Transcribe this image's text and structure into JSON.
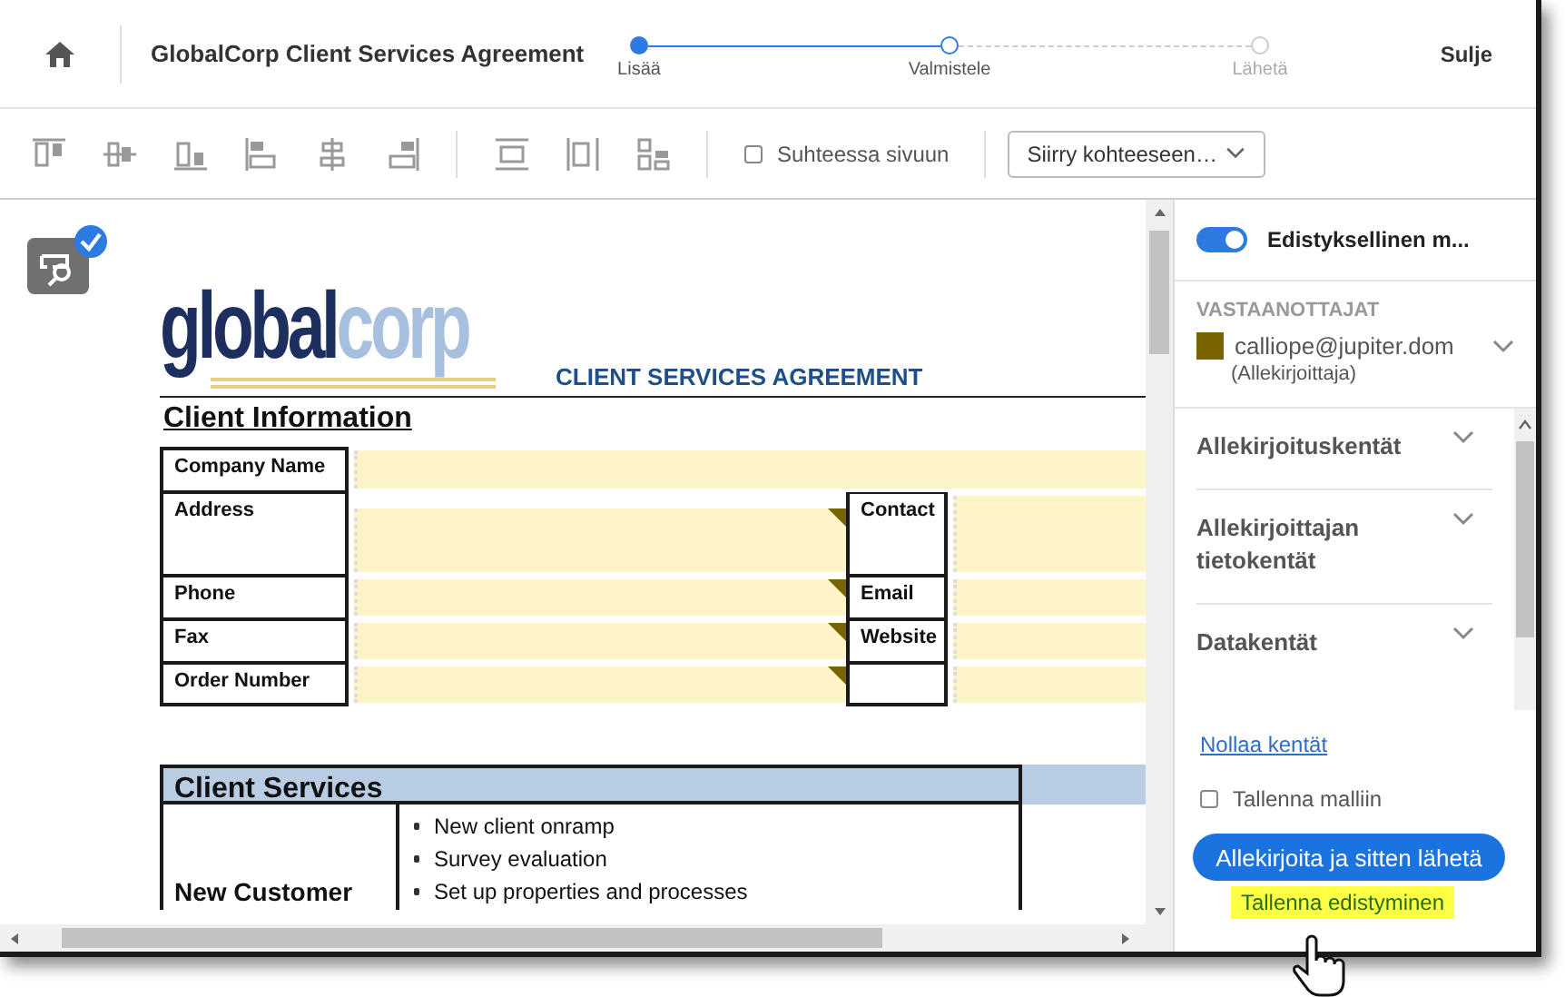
{
  "header": {
    "title": "GlobalCorp Client Services Agreement",
    "close": "Sulje"
  },
  "steps": [
    {
      "label": "Lisää",
      "kind": "done"
    },
    {
      "label": "Valmistele",
      "kind": "current"
    },
    {
      "label": "Lähetä",
      "kind": "pending"
    }
  ],
  "toolbar": {
    "fit_to_page": {
      "label": "Suhteessa sivuun",
      "checked": false
    },
    "goto": {
      "value": "Siirry kohteeseen…"
    }
  },
  "document": {
    "logo": [
      "global",
      "corp"
    ],
    "heading": "CLIENT SERVICES AGREEMENT",
    "section_title": "Client Information",
    "client_info_rows": [
      {
        "label": "Company Name",
        "kind": "wide"
      },
      {
        "label": "Address",
        "kind": "split",
        "contact_label": "Contact"
      },
      {
        "label": "Phone",
        "kind": "split",
        "contact_label": "Email"
      },
      {
        "label": "Fax",
        "kind": "split",
        "contact_label": "Website"
      },
      {
        "label": "Order Number",
        "kind": "split"
      }
    ],
    "services": {
      "title": "Client Services",
      "rows": [
        {
          "label": "New Customer",
          "items": [
            "New client onramp",
            "Survey evaluation",
            "Set up properties and processes"
          ]
        }
      ]
    }
  },
  "panel": {
    "advanced_toggle": {
      "label": "Edistyksellinen m...",
      "on": true
    },
    "recipients": {
      "title": "VASTAANOTTAJAT",
      "items": [
        {
          "email": "calliope@jupiter.dom",
          "role": "(Allekirjoittaja)",
          "color": "#7a6400"
        }
      ]
    },
    "sections": [
      {
        "label": "Allekirjoituskentät",
        "expanded": false
      },
      {
        "label": "Allekirjoittajan tietokentät",
        "expanded": false
      },
      {
        "label": "Datakentät",
        "expanded": false
      }
    ],
    "reset_link": "Nollaa kentät",
    "save_template": {
      "label": "Tallenna malliin",
      "checked": false
    },
    "primary_button": "Allekirjoita ja sitten lähetä",
    "save_progress": "Tallenna edistyminen"
  }
}
